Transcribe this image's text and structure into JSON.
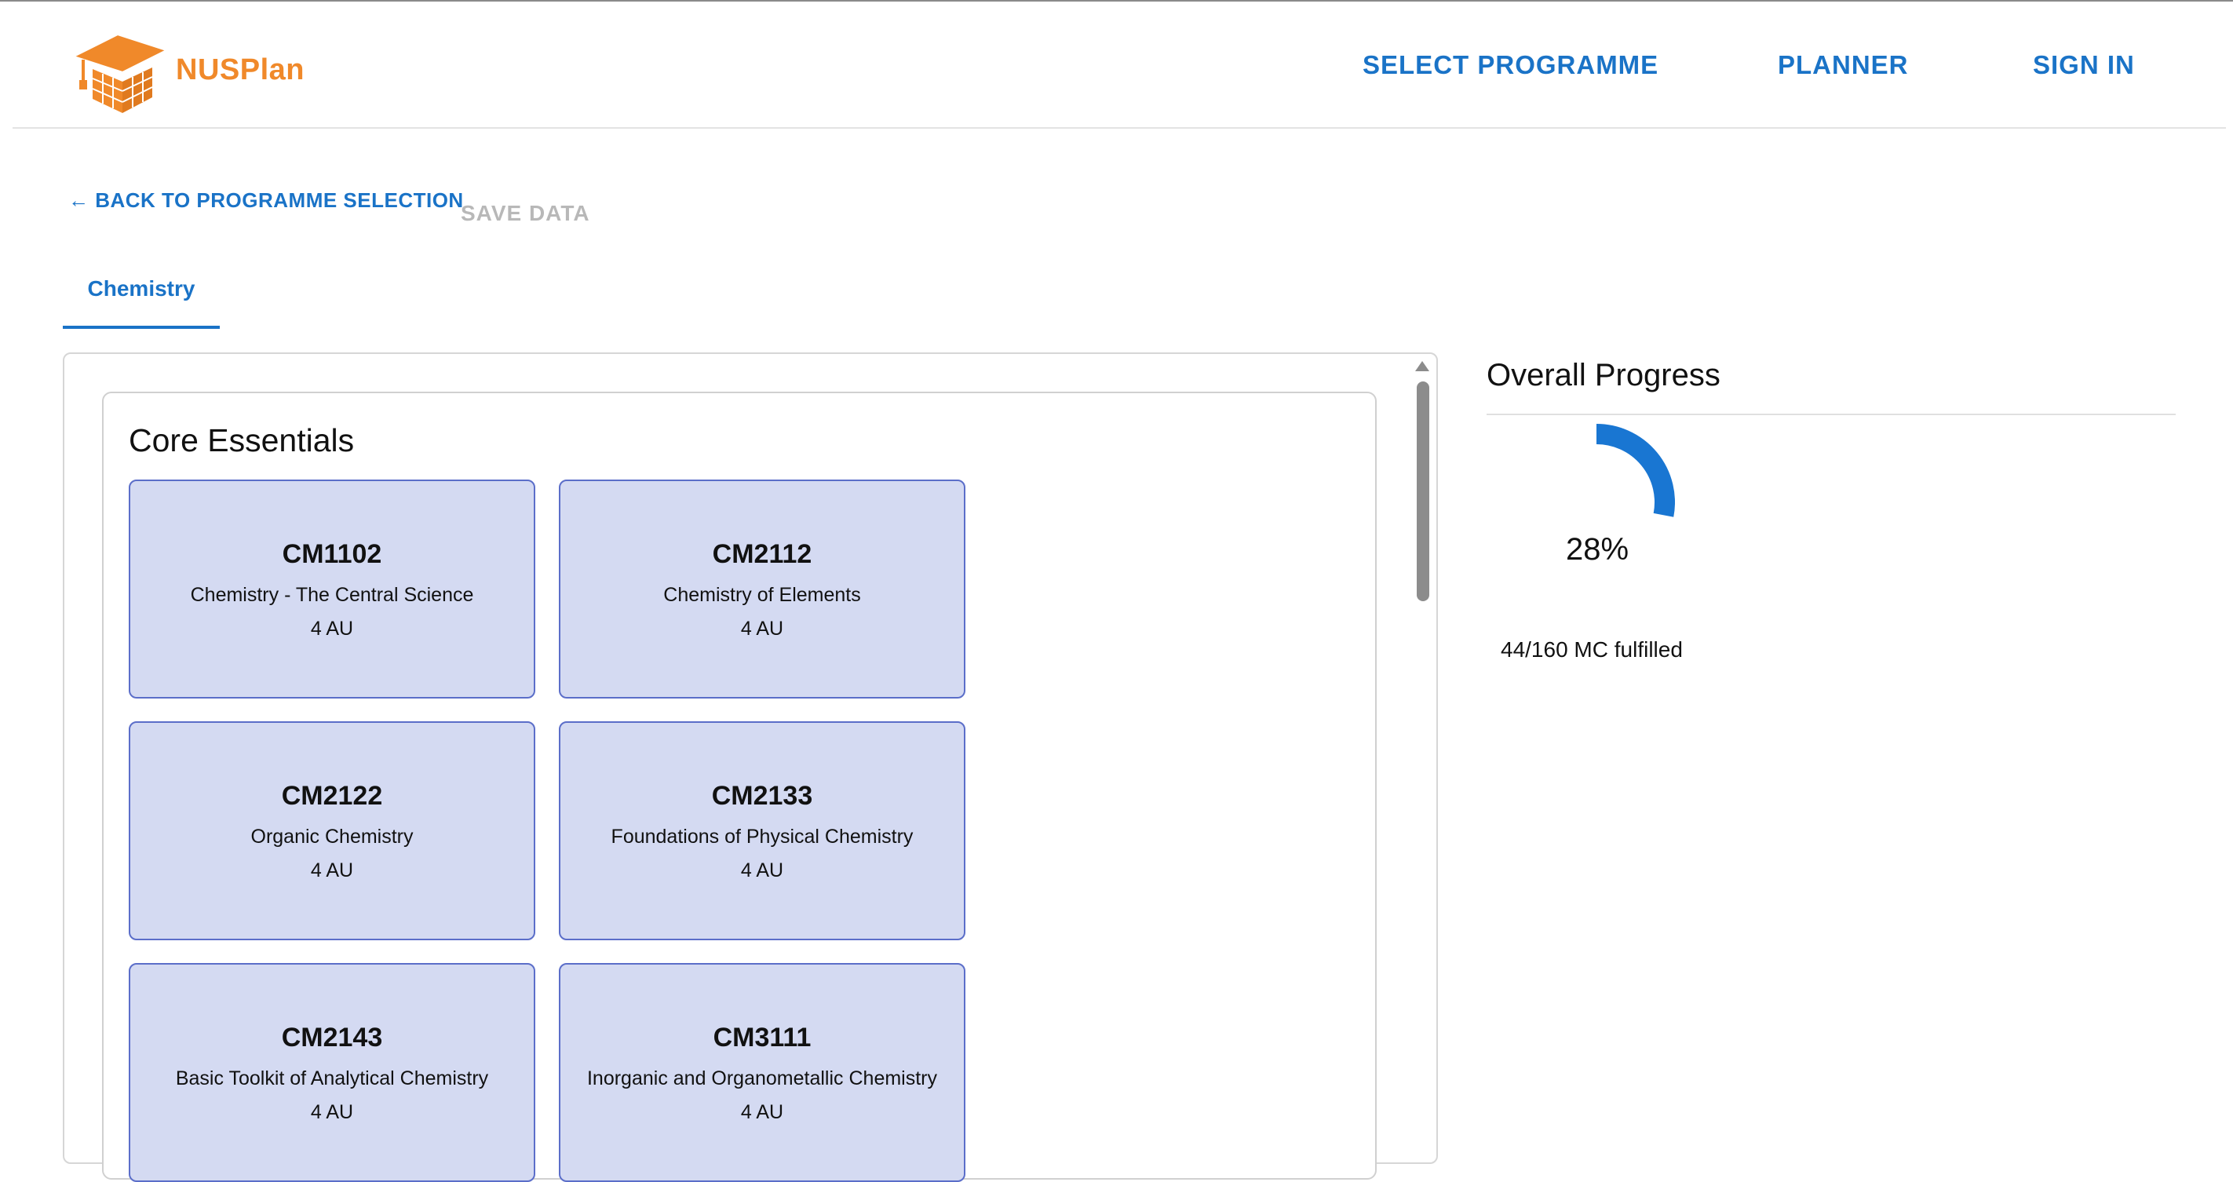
{
  "app": {
    "brand": "NUSPlan"
  },
  "nav": {
    "items": [
      {
        "label": "SELECT PROGRAMME"
      },
      {
        "label": "PLANNER"
      },
      {
        "label": "SIGN IN"
      }
    ]
  },
  "actions": {
    "back_label": "← BACK TO PROGRAMME SELECTION",
    "save_label": "SAVE DATA"
  },
  "tabs": [
    {
      "label": "Chemistry",
      "active": true
    }
  ],
  "requirement_group": {
    "title": "Core Essentials",
    "modules": [
      {
        "code": "CM1102",
        "title": "Chemistry - The Central Science",
        "units": "4 AU"
      },
      {
        "code": "CM2112",
        "title": "Chemistry of Elements",
        "units": "4 AU"
      },
      {
        "code": "CM2122",
        "title": "Organic Chemistry",
        "units": "4 AU"
      },
      {
        "code": "CM2133",
        "title": "Foundations of Physical Chemistry",
        "units": "4 AU"
      },
      {
        "code": "CM2143",
        "title": "Basic Toolkit of Analytical Chemistry",
        "units": "4 AU"
      },
      {
        "code": "CM3111",
        "title": "Inorganic and Organometallic Chemistry",
        "units": "4 AU"
      }
    ]
  },
  "progress": {
    "title": "Overall Progress",
    "percent_label": "28%",
    "fraction": 0.28,
    "fulfilled_label": "44/160 MC fulfilled",
    "color": "#1976d2"
  },
  "colors": {
    "brand_orange": "#f0892a",
    "primary_blue": "#1a73c7",
    "card_fill": "#d4daf2",
    "card_border": "#5b6ec9"
  }
}
